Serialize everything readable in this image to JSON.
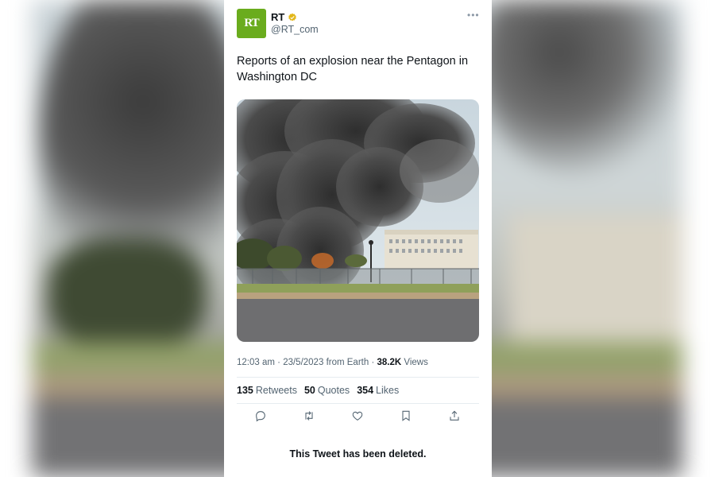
{
  "tweet": {
    "author": {
      "display_name": "RT",
      "handle": "@RT_com",
      "avatar_text": "RT",
      "verified": true,
      "verified_color": "#e2b719"
    },
    "text": "Reports of an explosion near the Pentagon in Washington DC",
    "meta": {
      "time": "12:03 am",
      "date": "23/5/2023",
      "source": "from Earth",
      "views_count": "38.2K",
      "views_label": "Views"
    },
    "stats": {
      "retweets": {
        "count": "135",
        "label": "Retweets"
      },
      "quotes": {
        "count": "50",
        "label": "Quotes"
      },
      "likes": {
        "count": "354",
        "label": "Likes"
      }
    },
    "actions": [
      "reply-icon",
      "retweet-icon",
      "like-icon",
      "bookmark-icon",
      "share-icon"
    ],
    "deleted_notice": "This Tweet has been deleted."
  },
  "colors": {
    "avatar_bg": "#6aac1d",
    "secondary_text": "#536471",
    "primary_text": "#0f1419"
  }
}
